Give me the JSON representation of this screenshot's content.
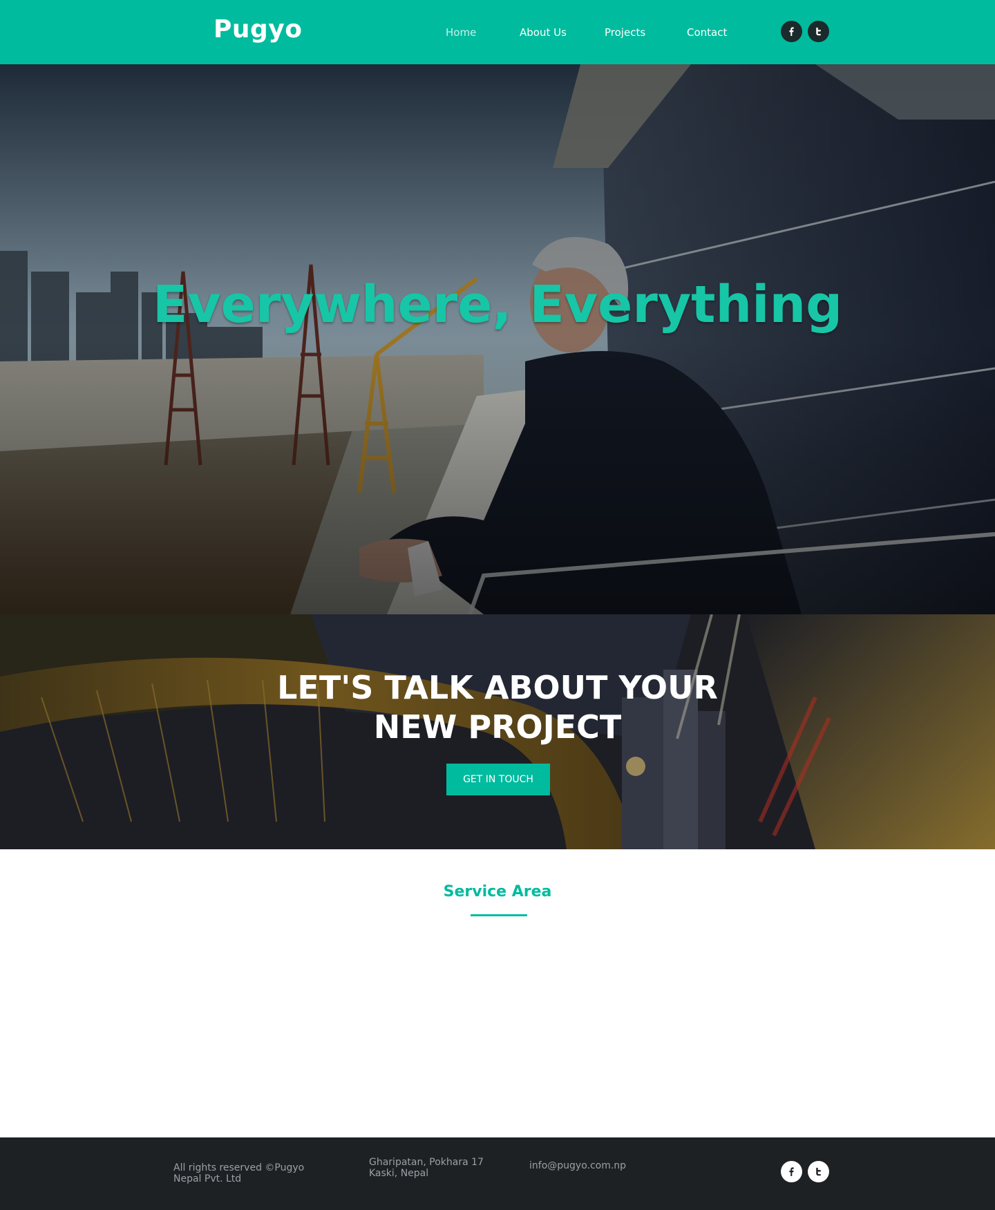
{
  "brand": {
    "logo": "Pugyo",
    "accent": "#00bb9e"
  },
  "nav": {
    "items": [
      {
        "label": "Home",
        "active": true
      },
      {
        "label": "About Us",
        "active": false
      },
      {
        "label": "Projects",
        "active": false
      },
      {
        "label": "Contact",
        "active": false
      }
    ]
  },
  "header_social": [
    {
      "icon": "facebook-icon"
    },
    {
      "icon": "twitter-icon"
    }
  ],
  "hero": {
    "title": "Everywhere, Everything"
  },
  "cta": {
    "title_line1": "LET'S TALK ABOUT YOUR",
    "title_line2": "NEW PROJECT",
    "button": "GET IN TOUCH"
  },
  "service": {
    "title": "Service Area"
  },
  "footer": {
    "copyright_line1": "All rights reserved ©Pugyo",
    "copyright_line2": "Nepal Pvt. Ltd",
    "address_line1": "Gharipatan, Pokhara 17",
    "address_line2": "Kaski, Nepal",
    "email": "info@pugyo.com.np"
  },
  "footer_social": [
    {
      "icon": "facebook-icon"
    },
    {
      "icon": "twitter-icon"
    }
  ]
}
